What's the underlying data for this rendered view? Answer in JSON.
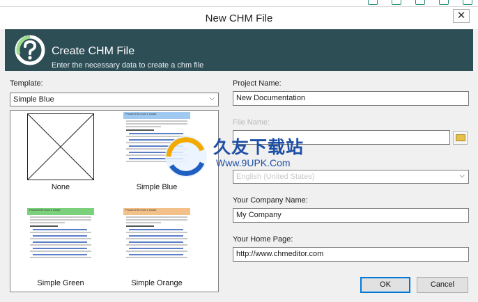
{
  "window": {
    "title": "New CHM File",
    "close_glyph": "✕"
  },
  "banner": {
    "icon": "help-question-icon",
    "title": "Create CHM File",
    "subtitle": "Enter the necessary data to create a chm file"
  },
  "template": {
    "label": "Template:",
    "value": "Simple Blue",
    "items": [
      {
        "name": "None",
        "accent": ""
      },
      {
        "name": "Simple Blue",
        "accent": "#9fc9f0"
      },
      {
        "name": "Simple Green",
        "accent": "#7bd07b"
      },
      {
        "name": "Simple Orange",
        "accent": "#f4c08a"
      }
    ]
  },
  "doc_preview": {
    "guide": "PowerCHM User's Guide",
    "heading": "Using PowerCHM",
    "section": "In This Section"
  },
  "project_name": {
    "label": "Project Name:",
    "value": "New Documentation"
  },
  "file_name": {
    "label": "File Name:",
    "value": ""
  },
  "language": {
    "value": "English (United States)"
  },
  "company_name": {
    "label": "Your Company Name:",
    "value": "My Company"
  },
  "home_page": {
    "label": "Your Home Page:",
    "value": "http://www.chmeditor.com"
  },
  "buttons": {
    "ok": "OK",
    "cancel": "Cancel"
  },
  "watermark": {
    "brand": "久友下载站",
    "site": "Www.9UPK.Com"
  }
}
